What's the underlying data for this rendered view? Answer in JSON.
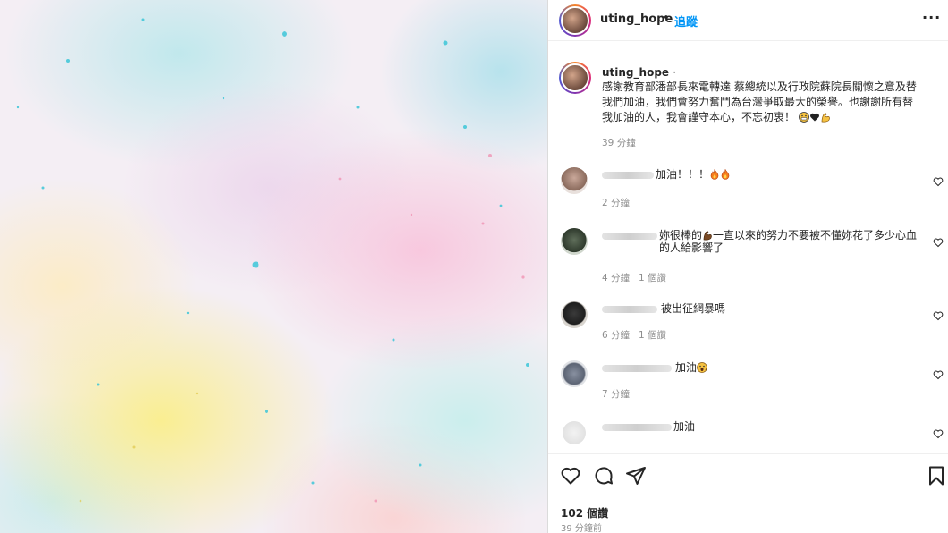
{
  "header": {
    "username": "uting_hope",
    "separator": "•",
    "follow_label": "追蹤",
    "more_icon": "more-options-icon",
    "more_label": "···"
  },
  "caption": {
    "username": "uting_hope",
    "dot": "·",
    "text": "感謝教育部潘部長來電轉達 蔡總統以及行政院蘇院長關懷之意及替我們加油，我們會努力奮鬥為台灣爭取最大的榮譽。也謝謝所有替我加油的人，我會謹守本心，不忘初衷！",
    "time": "39 分鐘"
  },
  "comments": [
    {
      "text": "加油！！！",
      "time": "2 分鐘",
      "replies": "",
      "emojis": [
        "fire-emoji",
        "fire-emoji"
      ]
    },
    {
      "text": "妳很棒的",
      "text2": "一直以來的努力不要被不懂妳花了多少心血的人給影響了",
      "time": "4 分鐘",
      "replies": "1 個讚",
      "emojis": [
        "flexed-biceps-emoji"
      ]
    },
    {
      "text": "被出征網暴嗎",
      "time": "6 分鐘",
      "replies": "1 個讚",
      "emojis": []
    },
    {
      "text": "加油",
      "time": "7 分鐘",
      "replies": "",
      "emojis": [
        "screaming-face-emoji"
      ]
    },
    {
      "text": "加油",
      "time": "",
      "replies": "",
      "emojis": []
    }
  ],
  "actions": {
    "like_icon": "heart-icon",
    "comment_icon": "comment-icon",
    "share_icon": "share-icon",
    "save_icon": "bookmark-icon"
  },
  "likes": "102 個讚",
  "posted": "39 分鐘前",
  "colors": {
    "link_blue": "#0095f6",
    "text": "#262626",
    "secondary_text": "#8e8e8e",
    "border": "#dbdbdb"
  }
}
